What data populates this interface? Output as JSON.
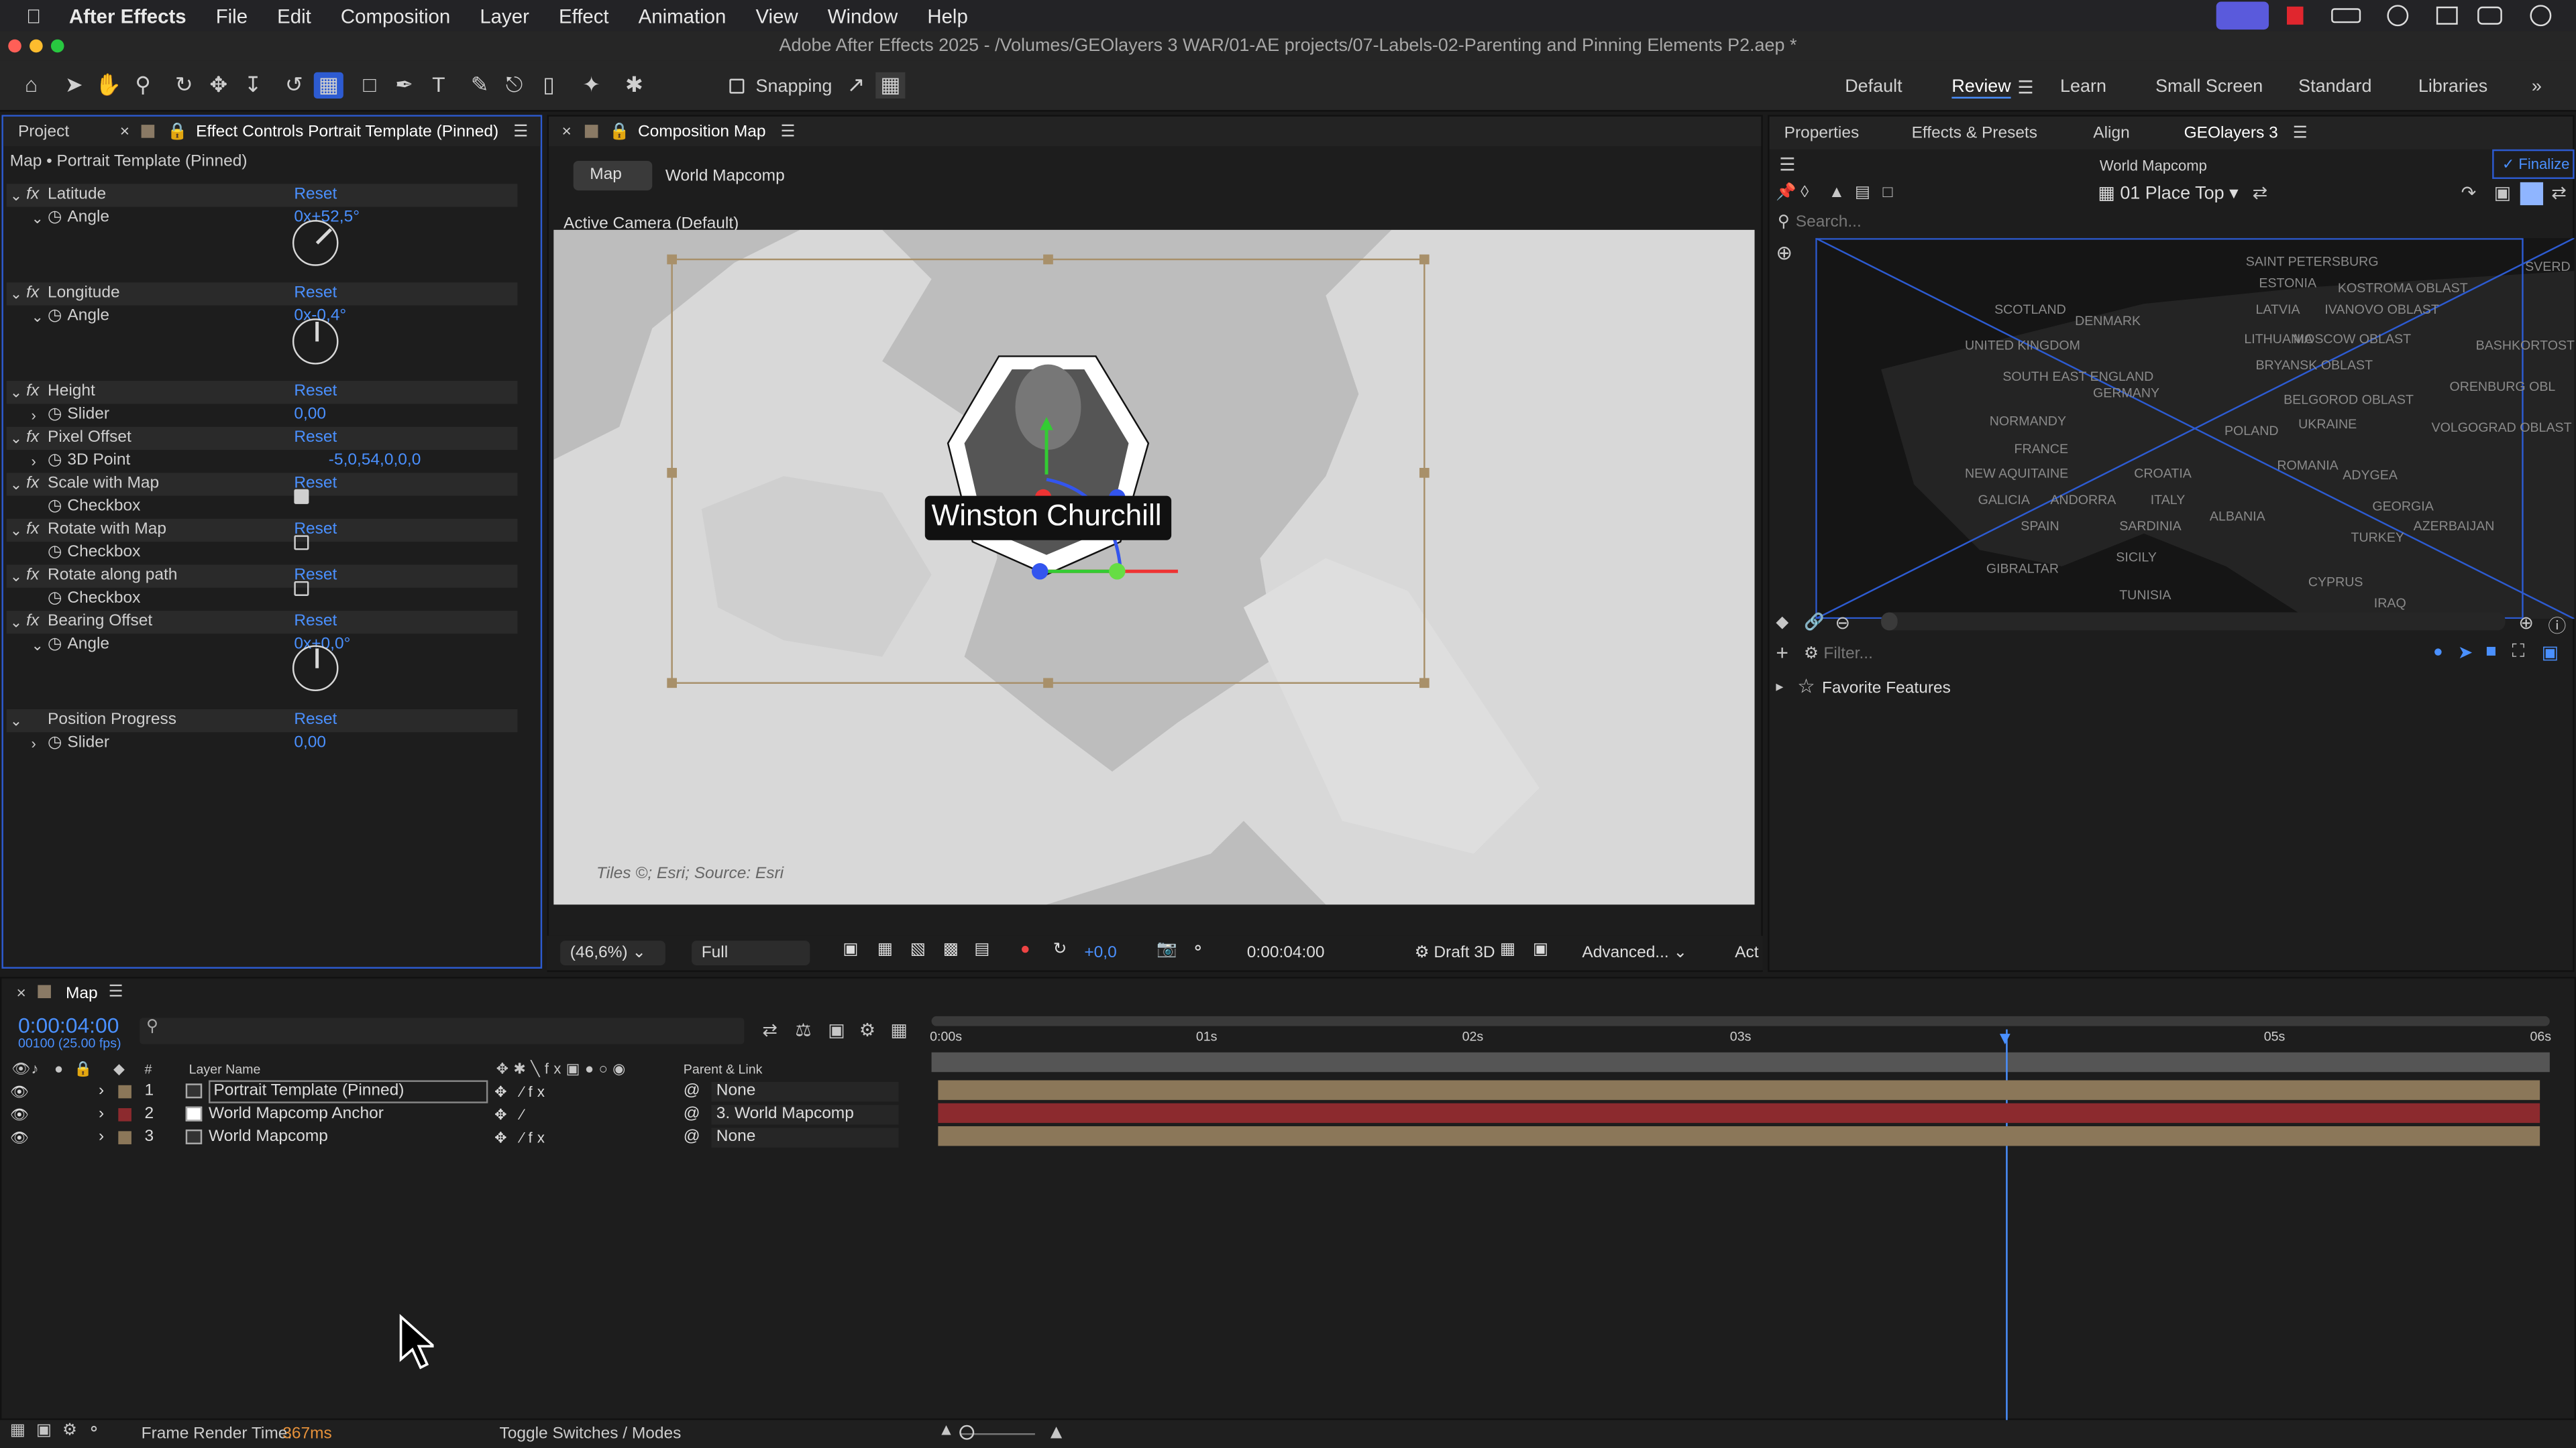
{
  "menubar": {
    "app": "After Effects",
    "items": [
      "File",
      "Edit",
      "Composition",
      "Layer",
      "Effect",
      "Animation",
      "View",
      "Window",
      "Help"
    ]
  },
  "titlebar": {
    "text": "Adobe After Effects 2025 - /Volumes/GEOlayers 3 WAR/01-AE projects/07-Labels-02-Parenting and Pinning Elements P2.aep *"
  },
  "toolbar": {
    "snapping": "Snapping",
    "workspaces": [
      "Default",
      "Review",
      "Learn",
      "Small Screen",
      "Standard",
      "Libraries"
    ]
  },
  "left_panel": {
    "tab_project": "Project",
    "tab_effects": "Effect Controls Portrait Template (Pinned)",
    "breadcrumb": "Map • Portrait Template (Pinned)",
    "rows": [
      {
        "label": "Latitude",
        "value": "Reset"
      },
      {
        "label": "Angle",
        "value": "0x+52,5°"
      },
      {
        "label": "Longitude",
        "value": "Reset"
      },
      {
        "label": "Angle",
        "value": "0x-0,4°"
      },
      {
        "label": "Height",
        "value": "Reset"
      },
      {
        "label": "Slider",
        "value": "0,00"
      },
      {
        "label": "Pixel Offset",
        "value": "Reset"
      },
      {
        "label": "3D Point",
        "value": "-5,0,54,0,0,0"
      },
      {
        "label": "Scale with Map",
        "value": "Reset"
      },
      {
        "label": "Checkbox",
        "value": ""
      },
      {
        "label": "Rotate with Map",
        "value": "Reset"
      },
      {
        "label": "Checkbox",
        "value": ""
      },
      {
        "label": "Rotate along path",
        "value": "Reset"
      },
      {
        "label": "Checkbox",
        "value": ""
      },
      {
        "label": "Bearing Offset",
        "value": "Reset"
      },
      {
        "label": "Angle",
        "value": "0x+0,0°"
      },
      {
        "label": "Position Progress",
        "value": "Reset"
      },
      {
        "label": "Slider",
        "value": "0,00"
      }
    ]
  },
  "comp": {
    "tab": "Composition Map",
    "crumb_map": "Map",
    "crumb_world": "World Mapcomp",
    "camera": "Active Camera (Default)",
    "label": "Winston Churchill",
    "credit": "Tiles ©; Esri; Source: Esri",
    "zoom": "(46,6%)",
    "res": "Full",
    "exposure": "+0,0",
    "time": "0:00:04:00",
    "renderer": "Draft 3D",
    "advanced": "Advanced...",
    "act": "Act"
  },
  "right_panel": {
    "tabs": [
      "Properties",
      "Effects & Presets",
      "Align",
      "GEOlayers 3"
    ],
    "finalize": "Finalize",
    "comp": "World Mapcomp",
    "place": "01 Place Top",
    "search": "Search...",
    "filter": "Filter...",
    "favorites": "Favorite Features",
    "map_labels": [
      "SAINT PETERSBURG",
      "ESTONIA",
      "KOSTROMA OBLAST",
      "SCOTLAND",
      "LATVIA",
      "IVANOVO OBLAST",
      "DENMARK",
      "LITHUANIA",
      "MOSCOW OBLAST",
      "UNITED KINGDOM",
      "BASHKORTOST",
      "BRYANSK OBLAST",
      "SOUTH EAST ENGLAND",
      "GERMANY",
      "BELGOROD OBLAST",
      "ORENBURG OBL",
      "NORMANDY",
      "POLAND",
      "UKRAINE",
      "VOLGOGRAD OBLAST",
      "FRANCE",
      "NEW AQUITAINE",
      "CROATIA",
      "ROMANIA",
      "ADYGEA",
      "GALICIA",
      "ANDORRA",
      "ITALY",
      "GEORGIA",
      "SPAIN",
      "SARDINIA",
      "ALBANIA",
      "AZERBAIJAN",
      "TURKEY",
      "GIBRALTAR",
      "SICILY",
      "CYPRUS",
      "TUNISIA",
      "IRAQ",
      "SVERD"
    ]
  },
  "timeline": {
    "tab": "Map",
    "time": "0:00:04:00",
    "frames": "00100 (25.00 fps)",
    "col_name": "Layer Name",
    "col_parent": "Parent & Link",
    "layers": [
      {
        "num": "1",
        "name": "Portrait Template (Pinned)",
        "parent": "None"
      },
      {
        "num": "2",
        "name": "World Mapcomp Anchor",
        "parent": "3. World Mapcomp"
      },
      {
        "num": "3",
        "name": "World Mapcomp",
        "parent": "None"
      }
    ],
    "ruler": [
      "0:00s",
      "01s",
      "02s",
      "03s",
      "05s",
      "06s"
    ]
  },
  "status": {
    "render_label": "Frame Render Time:",
    "render_value": "367ms",
    "toggle": "Toggle Switches / Modes"
  }
}
